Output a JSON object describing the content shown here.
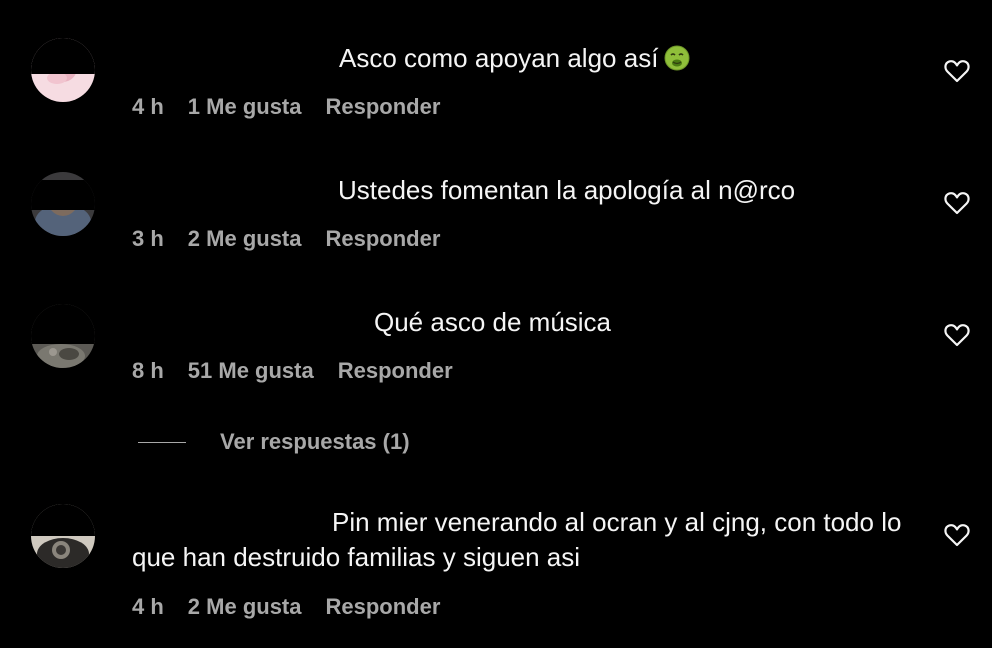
{
  "comments": [
    {
      "text": "Asco como apoyan algo así",
      "emoji": "nauseated-face-emoji",
      "time": "4 h",
      "likes": "1 Me gusta",
      "reply": "Responder"
    },
    {
      "text": "Ustedes fomentan la apología al n@rco",
      "time": "3 h",
      "likes": "2 Me gusta",
      "reply": "Responder"
    },
    {
      "text": "Qué asco de música",
      "time": "8 h",
      "likes": "51 Me gusta",
      "reply": "Responder",
      "view_replies": "Ver respuestas (1)"
    },
    {
      "text": "Pin mier venerando al ocran y al cjng, con todo lo que han destruido familias y siguen asi",
      "time": "4 h",
      "likes": "2 Me gusta",
      "reply": "Responder"
    }
  ],
  "colors": {
    "background": "#000000",
    "text_primary": "#f5f5f5",
    "text_secondary": "#a8a8a8"
  },
  "icons": {
    "like": "heart-outline-icon"
  }
}
